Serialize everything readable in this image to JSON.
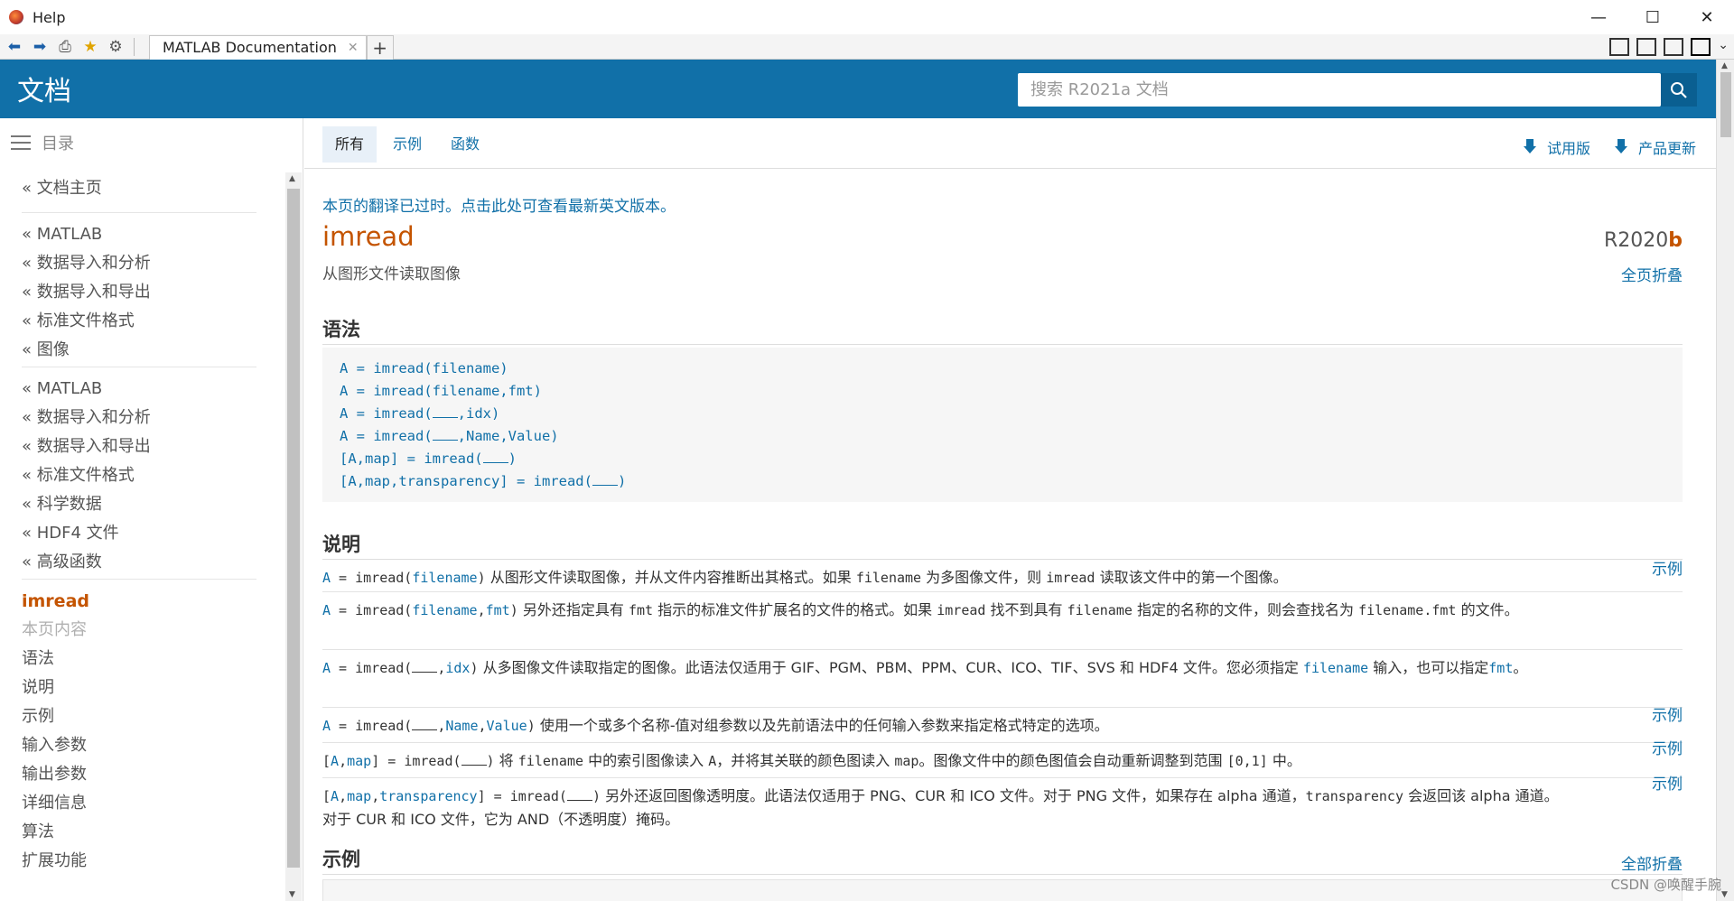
{
  "window": {
    "title": "Help"
  },
  "toolbar": {
    "tab_label": "MATLAB Documentation"
  },
  "header": {
    "title": "文档",
    "search_placeholder": "搜索 R2021a 文档"
  },
  "sidebar": {
    "toc_label": "目录",
    "home": "« 文档主页",
    "group1": [
      "« MATLAB",
      "« 数据导入和分析",
      "« 数据导入和导出",
      "« 标准文件格式",
      "« 图像"
    ],
    "group2": [
      "« MATLAB",
      "« 数据导入和分析",
      "« 数据导入和导出",
      "« 标准文件格式",
      "« 科学数据",
      "« HDF4 文件",
      "« 高级函数"
    ],
    "current": "imread",
    "on_page": "本页内容",
    "sections": [
      "语法",
      "说明",
      "示例",
      "输入参数",
      "输出参数",
      "详细信息",
      "算法",
      "扩展功能"
    ]
  },
  "filter": {
    "tabs": [
      "所有",
      "示例",
      "函数"
    ],
    "trial": "试用版",
    "updates": "产品更新"
  },
  "page": {
    "notice": "本页的翻译已过时。点击此处可查看最新英文版本。",
    "title": "imread",
    "release_r": "R",
    "release_year": "2020",
    "release_letter": "b",
    "subtitle": "从图形文件读取图像",
    "collapse_page": "全页折叠",
    "syntax_heading": "语法",
    "description_heading": "说明",
    "examples_heading": "示例",
    "collapse_all": "全部折叠",
    "example_link": "示例"
  },
  "syntax": {
    "l1": "A = imread(filename)",
    "l2": "A = imread(filename,fmt)",
    "l3a": "A = imread(",
    "l3b": ",idx)",
    "l4a": "A = imread(",
    "l4b": ",Name,Value)",
    "l5a": "[A,map] = imread(",
    "l5b": ")",
    "l6a": "[A,map,transparency] = imread(",
    "l6b": ")"
  },
  "desc": {
    "d1_text1": "从图形文件读取图像，并从文件内容推断出其格式。如果",
    "d1_text2": "为多图像文件，则",
    "d1_text3": "读取该文件中的第一个图像。",
    "d2_text1": "另外还指定具有",
    "d2_text2": "指示的标准文件扩展名的文件的格式。如果",
    "d2_text3": "找不到具有",
    "d2_text4": "指定的名称的文件，则会查找名为",
    "d2_text5": "的文件。",
    "d3_text1": "从多图像文件读取指定的图像。此语法仅适用于 GIF、PGM、PBM、PPM、CUR、ICO、TIF、SVS 和 HDF4 文件。您必须指定",
    "d3_text2": "输入，也可以指定",
    "d3_text3": "。",
    "d4_text1": "使用一个或多个名称-值对组参数以及先前语法中的任何输入参数来指定格式特定的选项。",
    "d5_text1": "将",
    "d5_text2": "中的索引图像读入",
    "d5_text3": "，并将其关联的颜色图读入",
    "d5_text4": "。图像文件中的颜色图值会自动重新调整到范围",
    "d5_text5": "中。",
    "d6_text1": "另外还返回图像透明度。此语法仅适用于 PNG、CUR 和 ICO 文件。对于 PNG 文件，如果存在 alpha 通道，",
    "d6_text2": "会返回该 alpha 通道。对于 CUR 和 ICO 文件，它为 AND（不透明度）掩码。"
  },
  "code_tokens": {
    "A": "A",
    "eq": " = ",
    "imread_open": "imread(",
    "close": ")",
    "filename": "filename",
    "fmt": "fmt",
    "comma": ",",
    "idx": "idx",
    "name": "Name",
    "value": "Value",
    "lb": "[",
    "rb": "]",
    "map": "map",
    "transparency": "transparency",
    "filename_fmt": "filename.fmt",
    "range": "[0,1]"
  },
  "watermark": "CSDN @唤醒手腕"
}
